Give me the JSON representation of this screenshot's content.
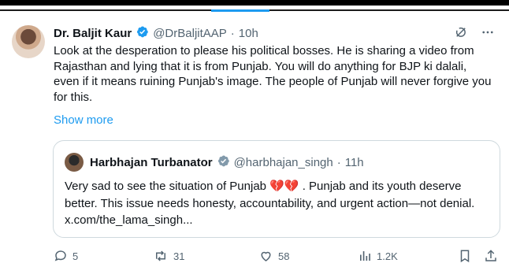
{
  "tweet": {
    "author_name": "Dr. Baljit Kaur",
    "handle": "@DrBaljitAAP",
    "separator": "·",
    "time": "10h",
    "text": "Look at the desperation to please his political bosses. He is sharing a video from Rajasthan and lying that it is from Punjab. You will do anything for BJP ki dalali, even if it means ruining Punjab's image. The people of Punjab will never forgive you for this.",
    "show_more": "Show more"
  },
  "quote": {
    "author_name": "Harbhajan Turbanator",
    "handle": "@harbhajan_singh",
    "separator": "·",
    "time": "11h",
    "text_before": "Very sad to see the situation of Punjab ",
    "emoji": "💔💔",
    "text_after": " . Punjab and its youth deserve better. This issue needs honesty, accountability, and urgent action—not denial. x.com/the_lama_singh..."
  },
  "engagement": {
    "replies": "5",
    "reposts": "31",
    "likes": "58",
    "views": "1.2K"
  },
  "colors": {
    "accent": "#1d9bf0",
    "secondary_text": "#536471",
    "border": "#cfd9de"
  },
  "icons": [
    "grok-icon",
    "more-icon",
    "verified-icon",
    "reply-icon",
    "repost-icon",
    "like-icon",
    "views-icon",
    "bookmark-icon",
    "share-icon"
  ]
}
